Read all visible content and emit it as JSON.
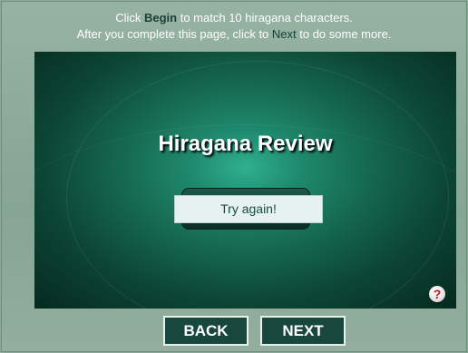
{
  "instructions": {
    "line1_pre": "Click ",
    "line1_begin": "Begin",
    "line1_post": " to match 10 hiragana characters.",
    "line2_pre": "After you complete this page, click to ",
    "line2_next": "Next",
    "line2_post": " to do some more."
  },
  "stage": {
    "title": "Hiragana Review",
    "try_again_label": "Try again!",
    "help_label": "?"
  },
  "nav": {
    "back_label": "BACK",
    "next_label": "NEXT"
  },
  "colors": {
    "frame": "#8aaa98",
    "stage_center": "#2fb08e",
    "stage_edge": "#062a1f",
    "nav_button": "#18473d",
    "help_mark": "#c0181c"
  },
  "icons": {
    "help": "question-mark-icon"
  }
}
